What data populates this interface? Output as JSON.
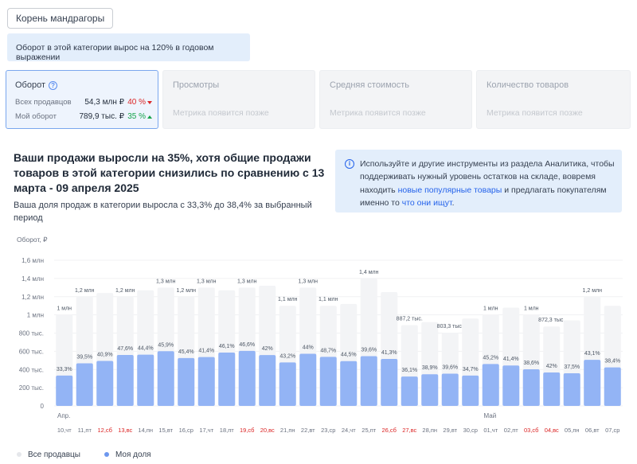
{
  "category_button": "Корень мандрагоры",
  "banner_text": "Оборот в этой категории вырос на 120% в годовом выражении",
  "metrics": {
    "turnover": {
      "title": "Оборот",
      "all_sellers_label": "Всех продавцов",
      "all_sellers_value": "54,3 млн ₽",
      "all_sellers_change": "40 %",
      "my_label": "Мой оборот",
      "my_value": "789,9 тыс. ₽",
      "my_change": "35 %"
    },
    "views": {
      "title": "Просмотры",
      "placeholder": "Метрика появится позже"
    },
    "avg_cost": {
      "title": "Средняя стоимость",
      "placeholder": "Метрика появится позже"
    },
    "items_count": {
      "title": "Количество товаров",
      "placeholder": "Метрика появится позже"
    }
  },
  "headline": "Ваши продажи выросли на 35%, хотя общие продажи товаров в этой категории снизились по сравнению с 13 марта - 09 апреля 2025",
  "subline": "Ваша доля продаж в категории выросла с 33,3% до 38,4% за выбранный период",
  "tip": {
    "text_1": "Используйте и другие инструменты из раздела Аналитика, чтобы поддерживать нужный уровень остатков на складе, вовремя находить ",
    "link_1": "новые популярные товары",
    "text_2": " и предлагать покупателям именно то ",
    "link_2": "что они ищут",
    "text_3": "."
  },
  "colors": {
    "total_bar": "#f3f4f6",
    "share_bar": "#93b4f5",
    "weekend": "#dc2626",
    "link": "#2563eb"
  },
  "chart_data": {
    "type": "bar",
    "ylabel": "Оборот, ₽",
    "ylim": [
      0,
      1600000
    ],
    "y_ticks": [
      "0",
      "200 тыс.",
      "400 тыс.",
      "600 тыс.",
      "800 тыс.",
      "1 млн",
      "1,2 млн",
      "1,4 млн",
      "1,6 млн"
    ],
    "month_labels": [
      {
        "index": 0,
        "label": "Апр."
      },
      {
        "index": 21,
        "label": "Май"
      }
    ],
    "categories": [
      "10,чт",
      "11,пт",
      "12,сб",
      "13,вс",
      "14,пн",
      "15,вт",
      "16,ср",
      "17,чт",
      "18,пт",
      "19,сб",
      "20,вс",
      "21,пн",
      "22,вт",
      "23,ср",
      "24,чт",
      "25,пт",
      "26,сб",
      "27,вс",
      "28,пн",
      "29,вт",
      "30,ср",
      "01,чт",
      "02,пт",
      "03,сб",
      "04,вс",
      "05,пн",
      "06,вт",
      "07,ср"
    ],
    "weekend": [
      false,
      false,
      true,
      true,
      false,
      false,
      false,
      false,
      false,
      true,
      true,
      false,
      false,
      false,
      false,
      false,
      true,
      true,
      false,
      false,
      false,
      false,
      false,
      true,
      true,
      false,
      false,
      false
    ],
    "series": [
      {
        "name": "Все продавцы",
        "values": [
          1000000,
          1200000,
          1240000,
          1200000,
          1270000,
          1300000,
          1200000,
          1300000,
          1270000,
          1300000,
          1320000,
          1100000,
          1300000,
          1100000,
          1120000,
          1400000,
          1250000,
          887200,
          920000,
          803300,
          960000,
          1000000,
          1080000,
          1000000,
          872300,
          940000,
          1200000,
          1100000
        ],
        "labels": [
          "1 млн",
          "1,2 млн",
          "",
          "1,2 млн",
          "",
          "1,3 млн",
          "1,2 млн",
          "1,3 млн",
          "",
          "1,3 млн",
          "",
          "1,1 млн",
          "1,3 млн",
          "1,1 млн",
          "",
          "1,4 млн",
          "",
          "887,2 тыс.",
          "",
          "803,3 тыс.",
          "",
          "1 млн",
          "",
          "1 млн",
          "872,3 тыс.",
          "",
          "1,2 млн",
          ""
        ]
      },
      {
        "name": "Моя доля",
        "values": [
          333000,
          468000,
          494000,
          560000,
          563000,
          601000,
          526000,
          537000,
          586000,
          604000,
          559000,
          478000,
          573000,
          539000,
          492000,
          546000,
          516000,
          322000,
          348000,
          354000,
          333000,
          460000,
          444000,
          402000,
          367000,
          359000,
          506000,
          423000
        ],
        "labels": [
          "33,3%",
          "39,5%",
          "40,9%",
          "47,6%",
          "44,4%",
          "45,9%",
          "45,4%",
          "41,4%",
          "46,1%",
          "46,6%",
          "42%",
          "43,2%",
          "44%",
          "48,7%",
          "44,5%",
          "39,6%",
          "41,3%",
          "36,1%",
          "38,9%",
          "39,6%",
          "34,7%",
          "45,2%",
          "41,4%",
          "38,6%",
          "42%",
          "37,5%",
          "43,1%",
          "38,4%"
        ]
      }
    ]
  },
  "legend": {
    "all_sellers": "Все продавцы",
    "my_share": "Моя доля"
  }
}
